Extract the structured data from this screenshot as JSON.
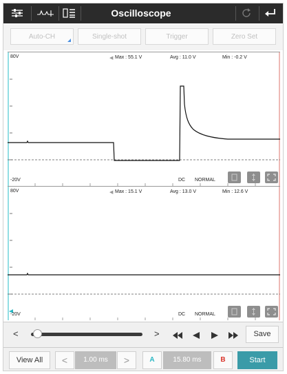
{
  "topbar": {
    "title": "Oscilloscope"
  },
  "modes": [
    "Auto-CH",
    "Single-shot",
    "Trigger",
    "Zero Set"
  ],
  "channel1": {
    "vmax_label": "80V",
    "vmin_label": "-20V",
    "max": "Max : 55.1 V",
    "avg": "Avg : 11.0 V",
    "min": "Min : -0.2 V",
    "coupling": "DC",
    "mode": "NORMAL"
  },
  "channel2": {
    "vmax_label": "80V",
    "vmin_label": "-20V",
    "max": "Max : 15.1 V",
    "avg": "Avg : 13.0 V",
    "min": "Min : 12.6 V",
    "coupling": "DC",
    "mode": "NORMAL"
  },
  "playback": {
    "prev": "<",
    "next": ">",
    "save_label": "Save",
    "position": 0.02
  },
  "controls": {
    "view_all": "View All",
    "timebase": "1.00 ms",
    "cursor_a": "A",
    "cursor_delta": "15.80 ms",
    "cursor_b": "B",
    "start": "Start"
  },
  "colors": {
    "accent": "#3a9ba8",
    "cursor_a": "#2bb7c4",
    "cursor_b": "#d9342b",
    "cursor_b_line": "#e8a39e",
    "cursor_a_line": "#6fd3da"
  }
}
